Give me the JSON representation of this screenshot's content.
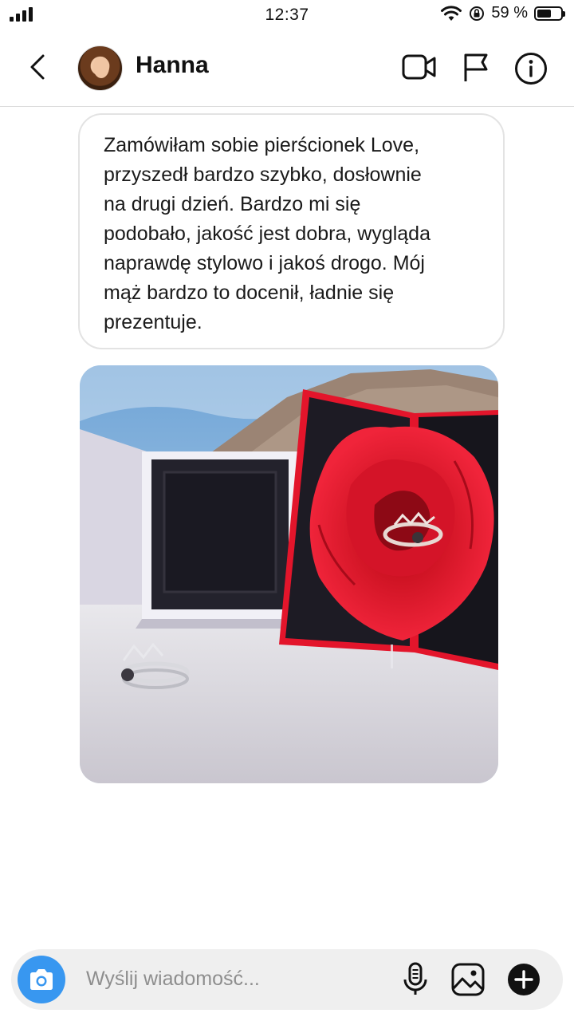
{
  "status_bar": {
    "time": "12:37",
    "battery_percent": "59 %",
    "battery_level": 0.59,
    "icons": [
      "cellular-signal-icon",
      "wifi-icon",
      "orientation-lock-icon",
      "battery-icon"
    ]
  },
  "header": {
    "contact_name": "Hanna",
    "icons": [
      "back-chevron-icon",
      "video-call-icon",
      "flag-icon",
      "info-icon"
    ]
  },
  "thread": {
    "message_text": "Zamówiłam sobie pierścionek Love, przyszedł bardzo szybko, dosłownie na drugi dzień. Bardzo mi się podobało, jakość jest dobra, wygląda naprawdę stylowo i jakoś drogo. Mój mąż bardzo to docenił, ładnie się prezentuje.",
    "message_lines": [
      "Zamówiłam sobie pierścionek Love,",
      "przyszedł bardzo szybko, dosłownie",
      "na drugi dzień. Bardzo mi się",
      "podobało, jakość jest dobra, wygląda",
      "naprawdę stylowo i jakoś drogo. Mój",
      "mąż bardzo to docenił, ładnie się",
      "prezentuje."
    ]
  },
  "composer": {
    "placeholder": "Wyślij wiadomość...",
    "icons": [
      "camera-icon",
      "microphone-icon",
      "gallery-icon",
      "plus-icon"
    ]
  },
  "colors": {
    "accent_blue": "#3897f0",
    "rose_red": "#e3152b",
    "divider": "#dcdcdc",
    "composer_bg": "#efefef",
    "placeholder": "#8e8e8e"
  }
}
